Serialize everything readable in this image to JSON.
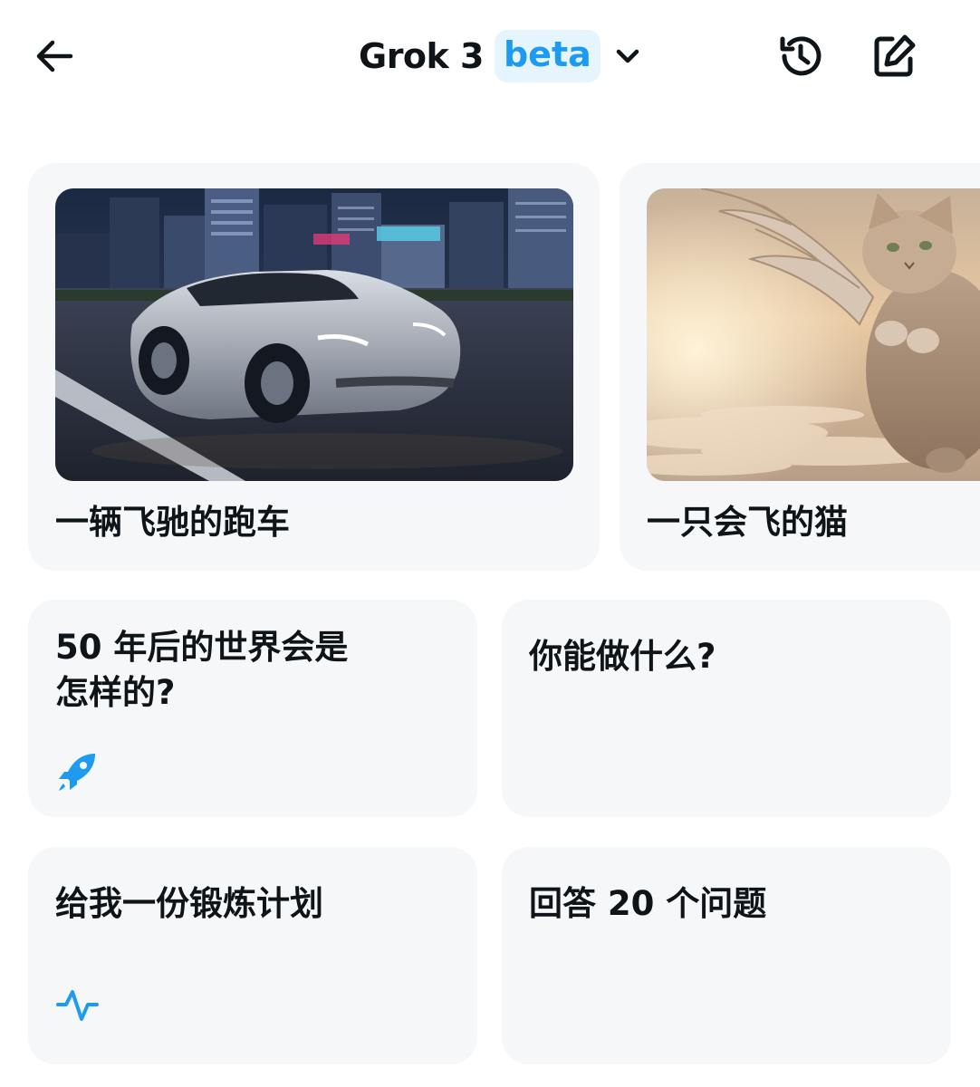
{
  "header": {
    "model_name": "Grok 3",
    "badge": "beta",
    "back_icon": "arrow-left-icon",
    "history_icon": "history-icon",
    "compose_icon": "compose-icon",
    "dropdown_icon": "chevron-down-icon"
  },
  "image_prompts": [
    {
      "label": "一辆飞驰的跑车",
      "image": "night-city-roadster"
    },
    {
      "label": "一只会飞的猫",
      "image": "winged-cat-in-sky"
    }
  ],
  "text_prompts": [
    {
      "label": "50 年后的世界会是\n怎样的?",
      "icon": "rocket-icon"
    },
    {
      "label": "你能做什么?"
    },
    {
      "label": "给我一份锻炼计划",
      "icon": "activity-pulse-icon"
    },
    {
      "label": "回答 20 个问题"
    }
  ],
  "colors": {
    "accent": "#1d9bf0",
    "badge_bg": "#e6f4fd",
    "card_bg": "#f5f7f8",
    "text": "#0f1419"
  }
}
